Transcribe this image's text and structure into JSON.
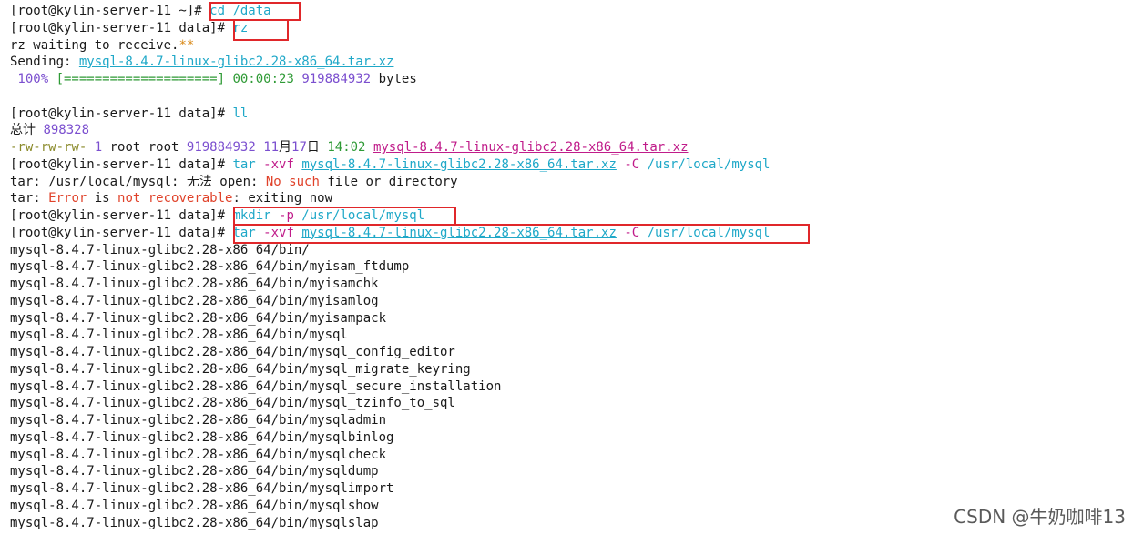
{
  "terminal": {
    "lines": [
      [
        [
          "c-default",
          "[root@kylin-server-11 ~]# "
        ],
        [
          "c-cmd",
          "cd /data"
        ]
      ],
      [
        [
          "c-default",
          "[root@kylin-server-11 data]# "
        ],
        [
          "c-cmd",
          "rz"
        ]
      ],
      [
        [
          "c-default",
          "rz waiting to receive."
        ],
        [
          "c-orange",
          "**"
        ]
      ],
      [
        [
          "c-default",
          "Sending: "
        ],
        [
          "c-file",
          "mysql-8.4.7-linux-glibc2.28-x86_64.tar.xz"
        ]
      ],
      [
        [
          "c-purple",
          " 100% "
        ],
        [
          "c-green",
          "[====================]"
        ],
        [
          "c-default",
          " "
        ],
        [
          "c-green",
          "00:00:23"
        ],
        [
          "c-default",
          " "
        ],
        [
          "c-purple",
          "919884932"
        ],
        [
          "c-default",
          " bytes"
        ]
      ],
      [
        [
          "c-default",
          ""
        ]
      ],
      [
        [
          "c-default",
          "[root@kylin-server-11 data]# "
        ],
        [
          "c-cmd",
          "ll"
        ]
      ],
      [
        [
          "c-default",
          "总计 "
        ],
        [
          "c-purple",
          "898328"
        ]
      ],
      [
        [
          "c-perm",
          "-rw-rw-rw-"
        ],
        [
          "c-default",
          " "
        ],
        [
          "c-purple",
          "1"
        ],
        [
          "c-default",
          " root root "
        ],
        [
          "c-purple",
          "919884932"
        ],
        [
          "c-default",
          " "
        ],
        [
          "c-purple",
          "11"
        ],
        [
          "c-default",
          "月"
        ],
        [
          "c-purple",
          "17"
        ],
        [
          "c-default",
          "日 "
        ],
        [
          "c-green",
          "14:02"
        ],
        [
          "c-default",
          " "
        ],
        [
          "c-magfile",
          "mysql-8.4.7-linux-glibc2.28-x86_64.tar.xz"
        ]
      ],
      [
        [
          "c-default",
          "[root@kylin-server-11 data]# "
        ],
        [
          "c-cmd",
          "tar "
        ],
        [
          "c-mag",
          "-xvf"
        ],
        [
          "c-cmd",
          " "
        ],
        [
          "c-file",
          "mysql-8.4.7-linux-glibc2.28-x86_64.tar.xz"
        ],
        [
          "c-cmd",
          " "
        ],
        [
          "c-mag",
          "-C"
        ],
        [
          "c-cmd",
          " /usr/local/mysql"
        ]
      ],
      [
        [
          "c-default",
          "tar: /usr/local/mysql: 无法 open: "
        ],
        [
          "c-red",
          "No such"
        ],
        [
          "c-default",
          " file or directory"
        ]
      ],
      [
        [
          "c-default",
          "tar: "
        ],
        [
          "c-red",
          "Error"
        ],
        [
          "c-default",
          " is "
        ],
        [
          "c-red",
          "not recoverable"
        ],
        [
          "c-default",
          ": exiting now"
        ]
      ],
      [
        [
          "c-default",
          "[root@kylin-server-11 data]# "
        ],
        [
          "c-cmd",
          "mkdir "
        ],
        [
          "c-mag",
          "-p"
        ],
        [
          "c-cmd",
          " /usr/local/mysql"
        ]
      ],
      [
        [
          "c-default",
          "[root@kylin-server-11 data]# "
        ],
        [
          "c-cmd",
          "tar "
        ],
        [
          "c-mag",
          "-xvf"
        ],
        [
          "c-cmd",
          " "
        ],
        [
          "c-file",
          "mysql-8.4.7-linux-glibc2.28-x86_64.tar.xz"
        ],
        [
          "c-cmd",
          " "
        ],
        [
          "c-mag",
          "-C"
        ],
        [
          "c-cmd",
          " /usr/local/mysql"
        ]
      ],
      [
        [
          "c-default",
          "mysql-8.4.7-linux-glibc2.28-x86_64/bin/"
        ]
      ],
      [
        [
          "c-default",
          "mysql-8.4.7-linux-glibc2.28-x86_64/bin/myisam_ftdump"
        ]
      ],
      [
        [
          "c-default",
          "mysql-8.4.7-linux-glibc2.28-x86_64/bin/myisamchk"
        ]
      ],
      [
        [
          "c-default",
          "mysql-8.4.7-linux-glibc2.28-x86_64/bin/myisamlog"
        ]
      ],
      [
        [
          "c-default",
          "mysql-8.4.7-linux-glibc2.28-x86_64/bin/myisampack"
        ]
      ],
      [
        [
          "c-default",
          "mysql-8.4.7-linux-glibc2.28-x86_64/bin/mysql"
        ]
      ],
      [
        [
          "c-default",
          "mysql-8.4.7-linux-glibc2.28-x86_64/bin/mysql_config_editor"
        ]
      ],
      [
        [
          "c-default",
          "mysql-8.4.7-linux-glibc2.28-x86_64/bin/mysql_migrate_keyring"
        ]
      ],
      [
        [
          "c-default",
          "mysql-8.4.7-linux-glibc2.28-x86_64/bin/mysql_secure_installation"
        ]
      ],
      [
        [
          "c-default",
          "mysql-8.4.7-linux-glibc2.28-x86_64/bin/mysql_tzinfo_to_sql"
        ]
      ],
      [
        [
          "c-default",
          "mysql-8.4.7-linux-glibc2.28-x86_64/bin/mysqladmin"
        ]
      ],
      [
        [
          "c-default",
          "mysql-8.4.7-linux-glibc2.28-x86_64/bin/mysqlbinlog"
        ]
      ],
      [
        [
          "c-default",
          "mysql-8.4.7-linux-glibc2.28-x86_64/bin/mysqlcheck"
        ]
      ],
      [
        [
          "c-default",
          "mysql-8.4.7-linux-glibc2.28-x86_64/bin/mysqldump"
        ]
      ],
      [
        [
          "c-default",
          "mysql-8.4.7-linux-glibc2.28-x86_64/bin/mysqlimport"
        ]
      ],
      [
        [
          "c-default",
          "mysql-8.4.7-linux-glibc2.28-x86_64/bin/mysqlshow"
        ]
      ],
      [
        [
          "c-default",
          "mysql-8.4.7-linux-glibc2.28-x86_64/bin/mysqlslap"
        ]
      ]
    ]
  },
  "watermark": "CSDN @牛奶咖啡13",
  "colors": {
    "background": "#ffffff",
    "highlight_box": "#e0272a",
    "command": "#1fa8c8",
    "option": "#c01c8a",
    "number": "#7b4fcf",
    "progress": "#2e9a35",
    "error": "#e0422a"
  }
}
